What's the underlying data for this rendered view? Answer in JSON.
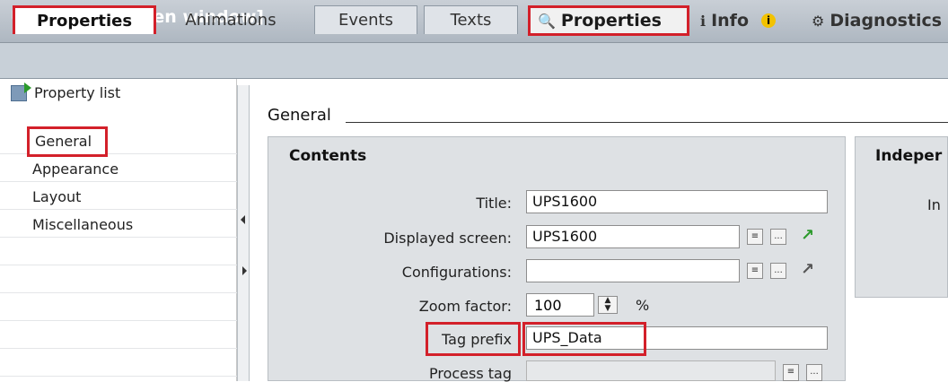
{
  "window": {
    "title": "UPS1600 [Screen window]"
  },
  "top_tabs": {
    "properties": "Properties",
    "info": "Info",
    "diagnostics": "Diagnostics"
  },
  "sub_tabs": [
    "Properties",
    "Animations",
    "Events",
    "Texts"
  ],
  "sidebar": {
    "header": "Property list",
    "items": [
      "General",
      "Appearance",
      "Layout",
      "Miscellaneous"
    ]
  },
  "main": {
    "section_title": "General",
    "contents": {
      "title": "Contents",
      "fields": {
        "title_label": "Title:",
        "title_value": "UPS1600",
        "screen_label": "Displayed screen:",
        "screen_value": "UPS1600",
        "config_label": "Configurations:",
        "config_value": "",
        "zoom_label": "Zoom factor:",
        "zoom_value": "100",
        "zoom_unit": "%",
        "tagprefix_label": "Tag prefix",
        "tagprefix_value": "UPS_Data",
        "processtag_label": "Process tag",
        "processtag_value": ""
      }
    },
    "independent": {
      "title": "Indeper",
      "label": "In"
    }
  },
  "icons": {
    "properties_tab": "magnifier-icon",
    "info_tab": "info-icon",
    "diagnostics_tab": "diagnostics-icon",
    "list_button": "list-icon",
    "browse_button": "ellipsis-icon",
    "goto_arrow": "arrow-icon"
  },
  "colors": {
    "highlight": "#d3202a",
    "goto_active": "#2c9a2c",
    "goto_inactive": "#555555"
  }
}
